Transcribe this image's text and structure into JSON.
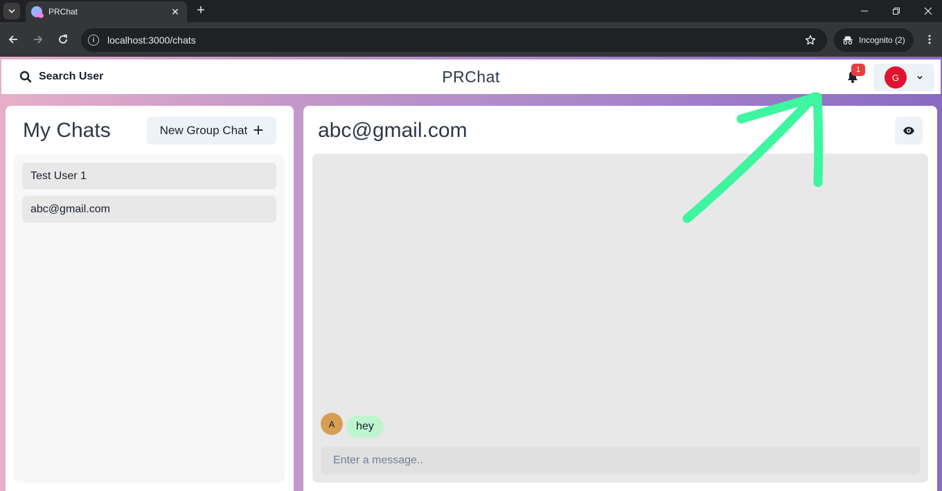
{
  "browser": {
    "tab_title": "PRChat",
    "url": "localhost:3000/chats",
    "incognito_label": "Incognito (2)"
  },
  "header": {
    "search_label": "Search User",
    "brand": "PRChat",
    "notification_count": "1",
    "avatar_initial": "G",
    "avatar_color": "#e2132f"
  },
  "sidebar": {
    "title": "My Chats",
    "new_group_label": "New Group Chat",
    "chats": [
      {
        "label": "Test User 1"
      },
      {
        "label": "abc@gmail.com"
      }
    ]
  },
  "chat": {
    "title": "abc@gmail.com",
    "messages": [
      {
        "avatar_initial": "A",
        "text": "hey"
      }
    ],
    "input_placeholder": "Enter a message.."
  },
  "annotation": {
    "arrow_color": "#3ef5a0"
  }
}
